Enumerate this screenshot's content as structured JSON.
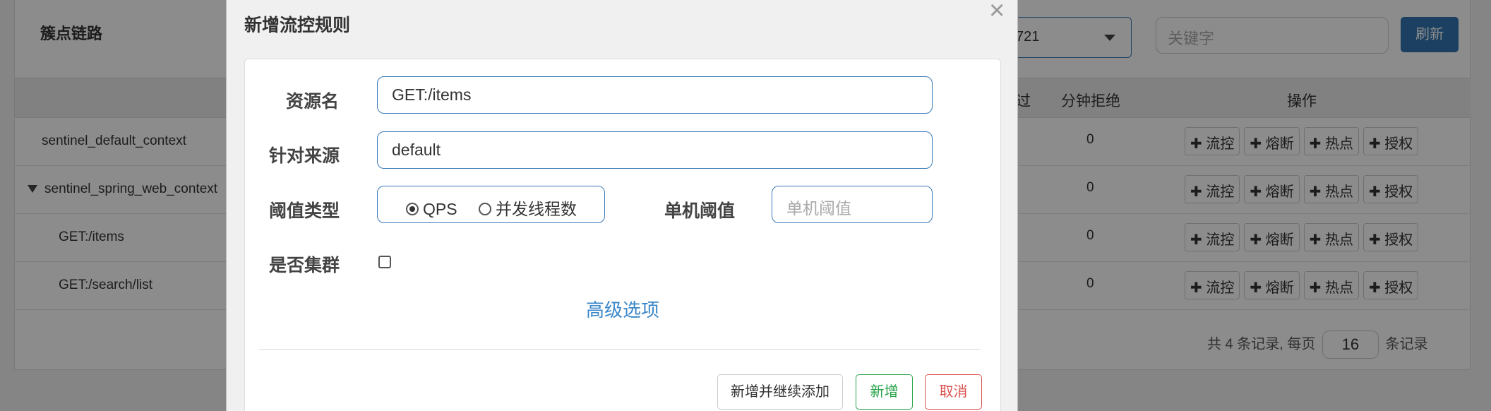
{
  "background": {
    "panel_title": "簇点链路",
    "app_select_value": "721",
    "keyword_placeholder": "关键字",
    "refresh_label": "刷新",
    "columns": {
      "pass_partial": "过",
      "block_per_min": "分钟拒绝",
      "actions": "操作"
    },
    "rows": [
      {
        "name": "sentinel_default_context",
        "block": "0"
      },
      {
        "name": "sentinel_spring_web_context",
        "block": "0"
      },
      {
        "name": "GET:/items",
        "block": "0"
      },
      {
        "name": "GET:/search/list",
        "block": "0"
      }
    ],
    "op_labels": [
      "✚ 流控",
      "✚ 熔断",
      "✚ 热点",
      "✚ 授权"
    ],
    "pager": {
      "prefix": "共 4 条记录, 每页",
      "page_size": "16",
      "suffix": "条记录"
    }
  },
  "modal": {
    "title": "新增流控规则",
    "close": "×",
    "resource_label": "资源名",
    "resource_value": "GET:/items",
    "origin_label": "针对来源",
    "origin_value": "default",
    "threshold_type_label": "阈值类型",
    "threshold_options": [
      "QPS",
      "并发线程数"
    ],
    "threshold_selected": "QPS",
    "single_threshold_label": "单机阈值",
    "single_threshold_placeholder": "单机阈值",
    "cluster_label": "是否集群",
    "cluster_checked": false,
    "advanced_link": "高级选项",
    "btn_add_continue": "新增并继续添加",
    "btn_add": "新增",
    "btn_cancel": "取消"
  },
  "colors": {
    "primary": "#3276b1",
    "success": "#2aa44a",
    "danger": "#d9534f",
    "link": "#3a87c8"
  }
}
